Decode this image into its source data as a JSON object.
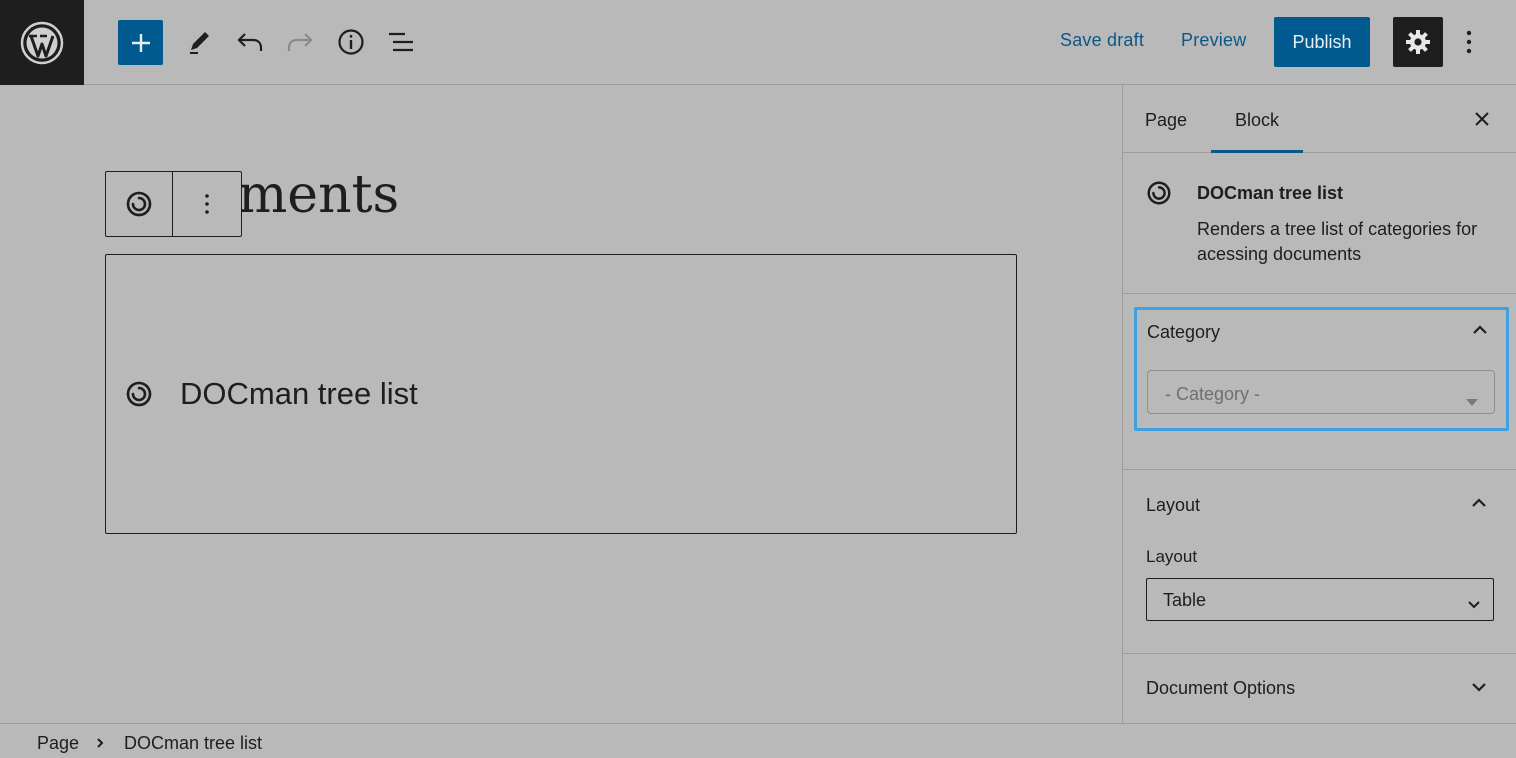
{
  "topbar": {
    "save_draft": "Save draft",
    "preview": "Preview",
    "publish": "Publish",
    "icons": [
      "wordpress-logo",
      "add-block",
      "edit-tools",
      "undo",
      "redo",
      "details-info",
      "list-view",
      "settings-gear",
      "options-more"
    ]
  },
  "editor": {
    "heading_partial": "ments",
    "block_label": "DOCman tree list"
  },
  "sidebar": {
    "tabs": [
      {
        "label": "Page",
        "active": false
      },
      {
        "label": "Block",
        "active": true
      }
    ],
    "block_card": {
      "title": "DOCman tree list",
      "description": "Renders a tree list of categories for acessing documents"
    },
    "category_panel": {
      "title": "Category",
      "select_placeholder": "- Category -"
    },
    "layout_panel": {
      "title": "Layout",
      "field_label": "Layout",
      "selected": "Table"
    },
    "document_options_panel": {
      "title": "Document Options"
    }
  },
  "footer": {
    "breadcrumb": [
      "Page",
      "DOCman tree list"
    ]
  },
  "colors": {
    "background": "#b9b9b9",
    "accent": "#005a8f",
    "link": "#0b5888",
    "focus_outline": "#3f9fe3",
    "dark": "#1e1e1e"
  }
}
